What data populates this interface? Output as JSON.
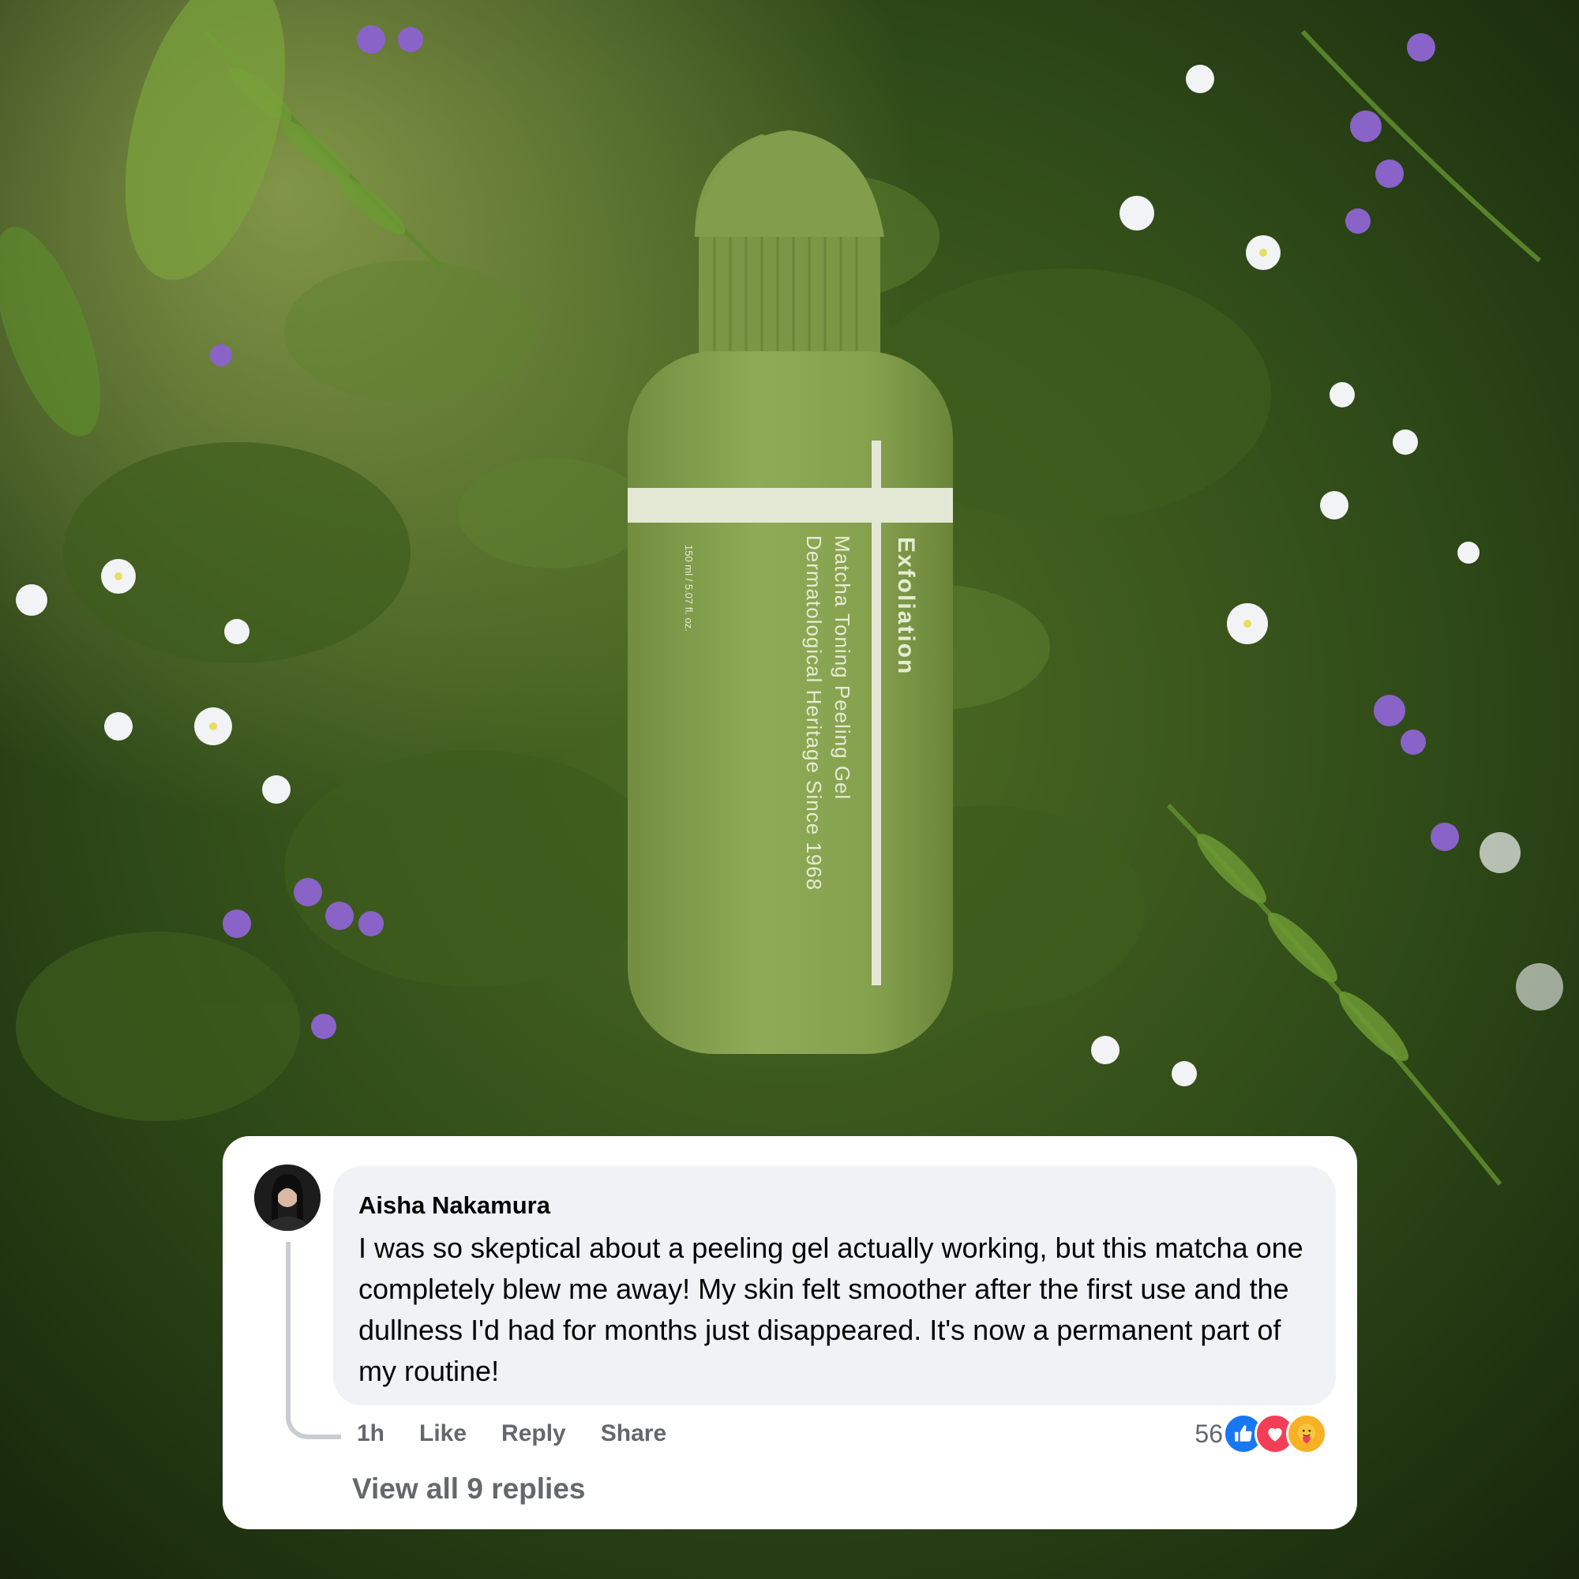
{
  "product": {
    "brand_line": "Exfoliation",
    "name": "Matcha Toning Peeling Gel",
    "tagline": "Dermatological Heritage Since 1968",
    "volume": "150 ml / 5.07 fl. oz."
  },
  "comment": {
    "author": "Aisha Nakamura",
    "text": "I was so skeptical about a peeling gel actually working, but this matcha one completely blew me away! My skin felt smoother after the first use and the dullness I'd had for months just disappeared. It's now a permanent part of my routine!",
    "time": "1h",
    "like_label": "Like",
    "reply_label": "Reply",
    "share_label": "Share",
    "reaction_count": "56",
    "reactions": [
      "like-icon",
      "love-icon",
      "care-icon"
    ],
    "view_replies_label": "View all 9 replies"
  },
  "colors": {
    "like": "#1877f2",
    "love": "#f33e58",
    "care": "#f7b125",
    "bottle": "#7f9a48",
    "muted_text": "#65676b"
  }
}
